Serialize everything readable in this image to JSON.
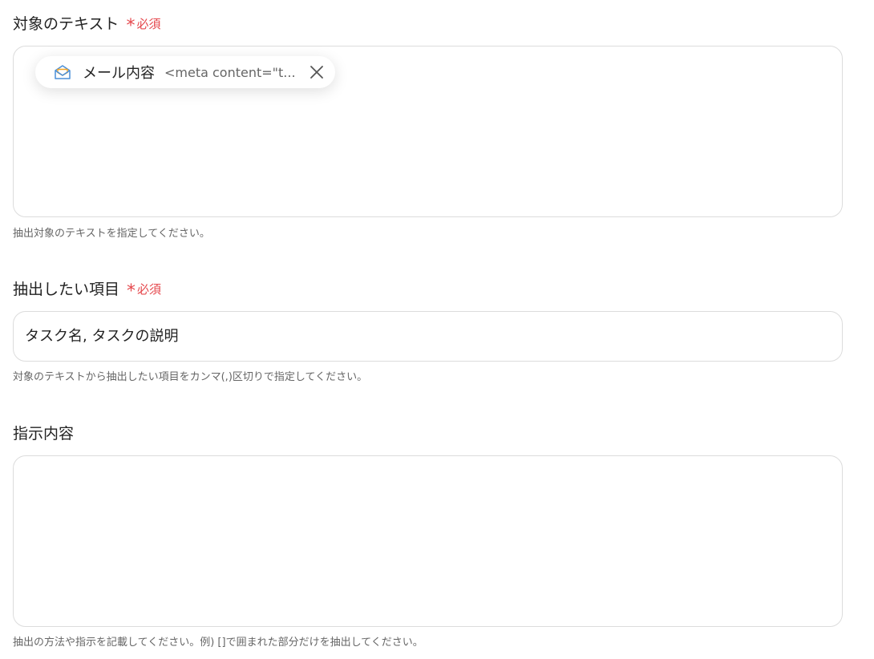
{
  "fields": {
    "target_text": {
      "label": "対象のテキスト",
      "required_label": "必須",
      "chip": {
        "name": "メール内容",
        "value": "<meta content=\"t...",
        "icon": "envelope-open-icon"
      },
      "helper": "抽出対象のテキストを指定してください。"
    },
    "extract_items": {
      "label": "抽出したい項目",
      "required_label": "必須",
      "value": "タスク名, タスクの説明",
      "helper": "対象のテキストから抽出したい項目をカンマ(,)区切りで指定してください。"
    },
    "instructions": {
      "label": "指示内容",
      "value": "",
      "helper": "抽出の方法や指示を記載してください。例) []で囲まれた部分だけを抽出してください。"
    }
  },
  "colors": {
    "required": "#e5484d",
    "border": "#dcdcdc",
    "helper_text": "#666666",
    "icon_blue": "#4a8fd8",
    "icon_orange": "#f5a623"
  }
}
